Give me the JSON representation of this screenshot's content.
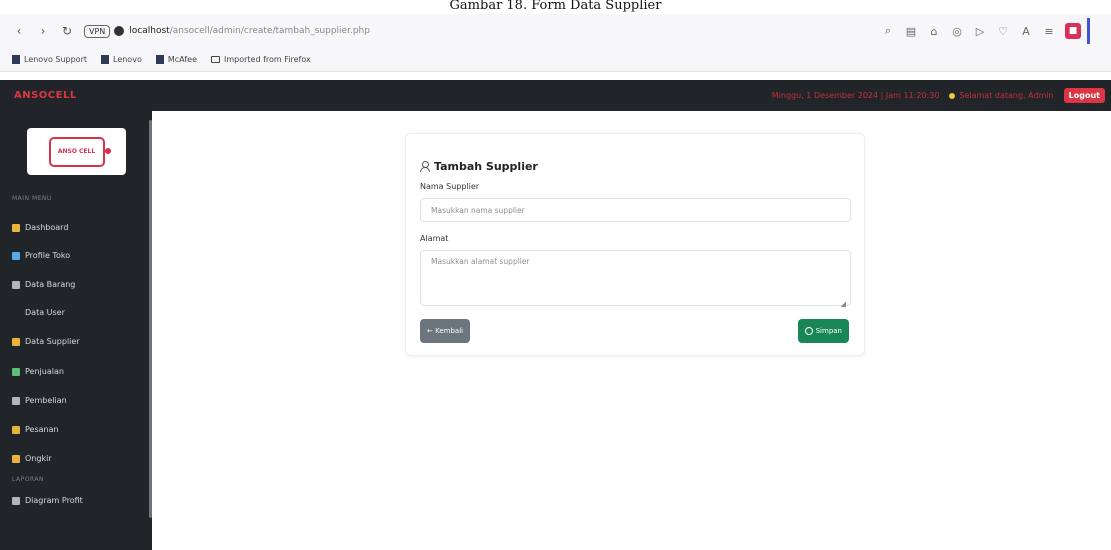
{
  "caption": "Gambar 18. Form Data Supplier",
  "browser": {
    "url_host": "localhost",
    "url_path": "/ansocell/admin/create/tambah_supplier.php",
    "site_badge": "VPN"
  },
  "bookmarks": [
    {
      "label": "Lenovo Support"
    },
    {
      "label": "Lenovo"
    },
    {
      "label": "McAfee"
    },
    {
      "label": "Imported from Firefox"
    }
  ],
  "navbar": {
    "brand": "ANSOCELL",
    "datetime": "Minggu, 1 Desember 2024 | Jam 11:20:30",
    "user": "Selamat datang, Admin",
    "logout": "Logout"
  },
  "sidebar": {
    "logo_text": "ANSO CELL",
    "section_main": "MAIN MENU",
    "section_report": "LAPORAN",
    "items": [
      {
        "label": "Dashboard"
      },
      {
        "label": "Profile Toko"
      },
      {
        "label": "Data Barang"
      },
      {
        "label": "Data User"
      },
      {
        "label": "Data Supplier"
      },
      {
        "label": "Penjualan"
      },
      {
        "label": "Pembelian"
      },
      {
        "label": "Pesanan"
      },
      {
        "label": "Ongkir"
      },
      {
        "label": "Diagram Profit"
      }
    ]
  },
  "form": {
    "title": "Tambah Supplier",
    "name_label": "Nama Supplier",
    "name_placeholder": "Masukkan nama supplier",
    "address_label": "Alamat",
    "address_placeholder": "Masukkan alamat supplier",
    "back_label": "← Kembali",
    "save_label": "Simpan"
  },
  "colors": {
    "navbar_bg": "#212529",
    "brand_red": "#dc3545",
    "save_green": "#198754",
    "back_grey": "#6c757d"
  }
}
